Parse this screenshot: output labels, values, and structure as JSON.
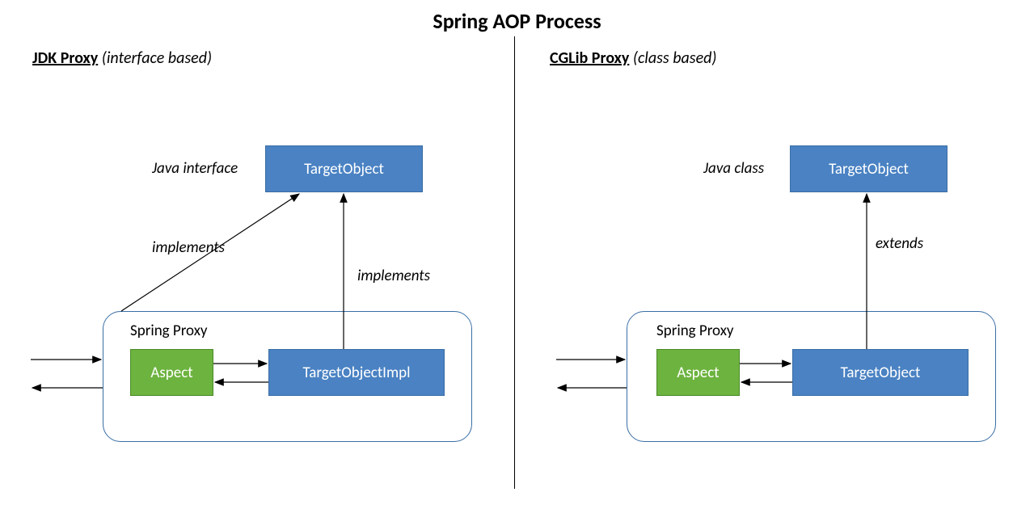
{
  "title": "Spring AOP Process",
  "left": {
    "header_main": "JDK Proxy",
    "header_sub": "(interface based)",
    "interface_label": "Java interface",
    "target_object": "TargetObject",
    "implements1": "implements",
    "implements2": "implements",
    "proxy_label": "Spring Proxy",
    "aspect": "Aspect",
    "target_impl": "TargetObjectImpl"
  },
  "right": {
    "header_main": "CGLib Proxy",
    "header_sub": "(class based)",
    "class_label": "Java class",
    "target_object": "TargetObject",
    "extends": "extends",
    "proxy_label": "Spring Proxy",
    "aspect": "Aspect",
    "target_object2": "TargetObject"
  }
}
